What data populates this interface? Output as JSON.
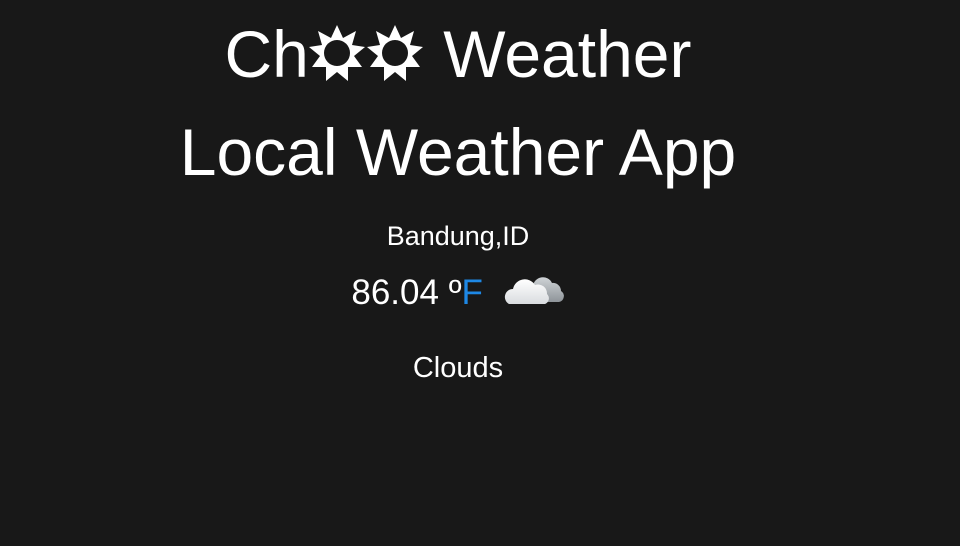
{
  "header": {
    "title_prefix": "Ch",
    "title_suffix": " Weather",
    "subtitle": "Local Weather App",
    "title_icons": [
      "sun-outline-icon",
      "sun-outline-icon"
    ]
  },
  "weather": {
    "location": "Bandung,ID",
    "temperature": "86.04",
    "degree_symbol": "º",
    "unit": "F",
    "condition_icon": "cloud-icon",
    "description": "Clouds"
  },
  "colors": {
    "background": "#181818",
    "text": "#ffffff",
    "unit_accent": "#1e88e5"
  }
}
